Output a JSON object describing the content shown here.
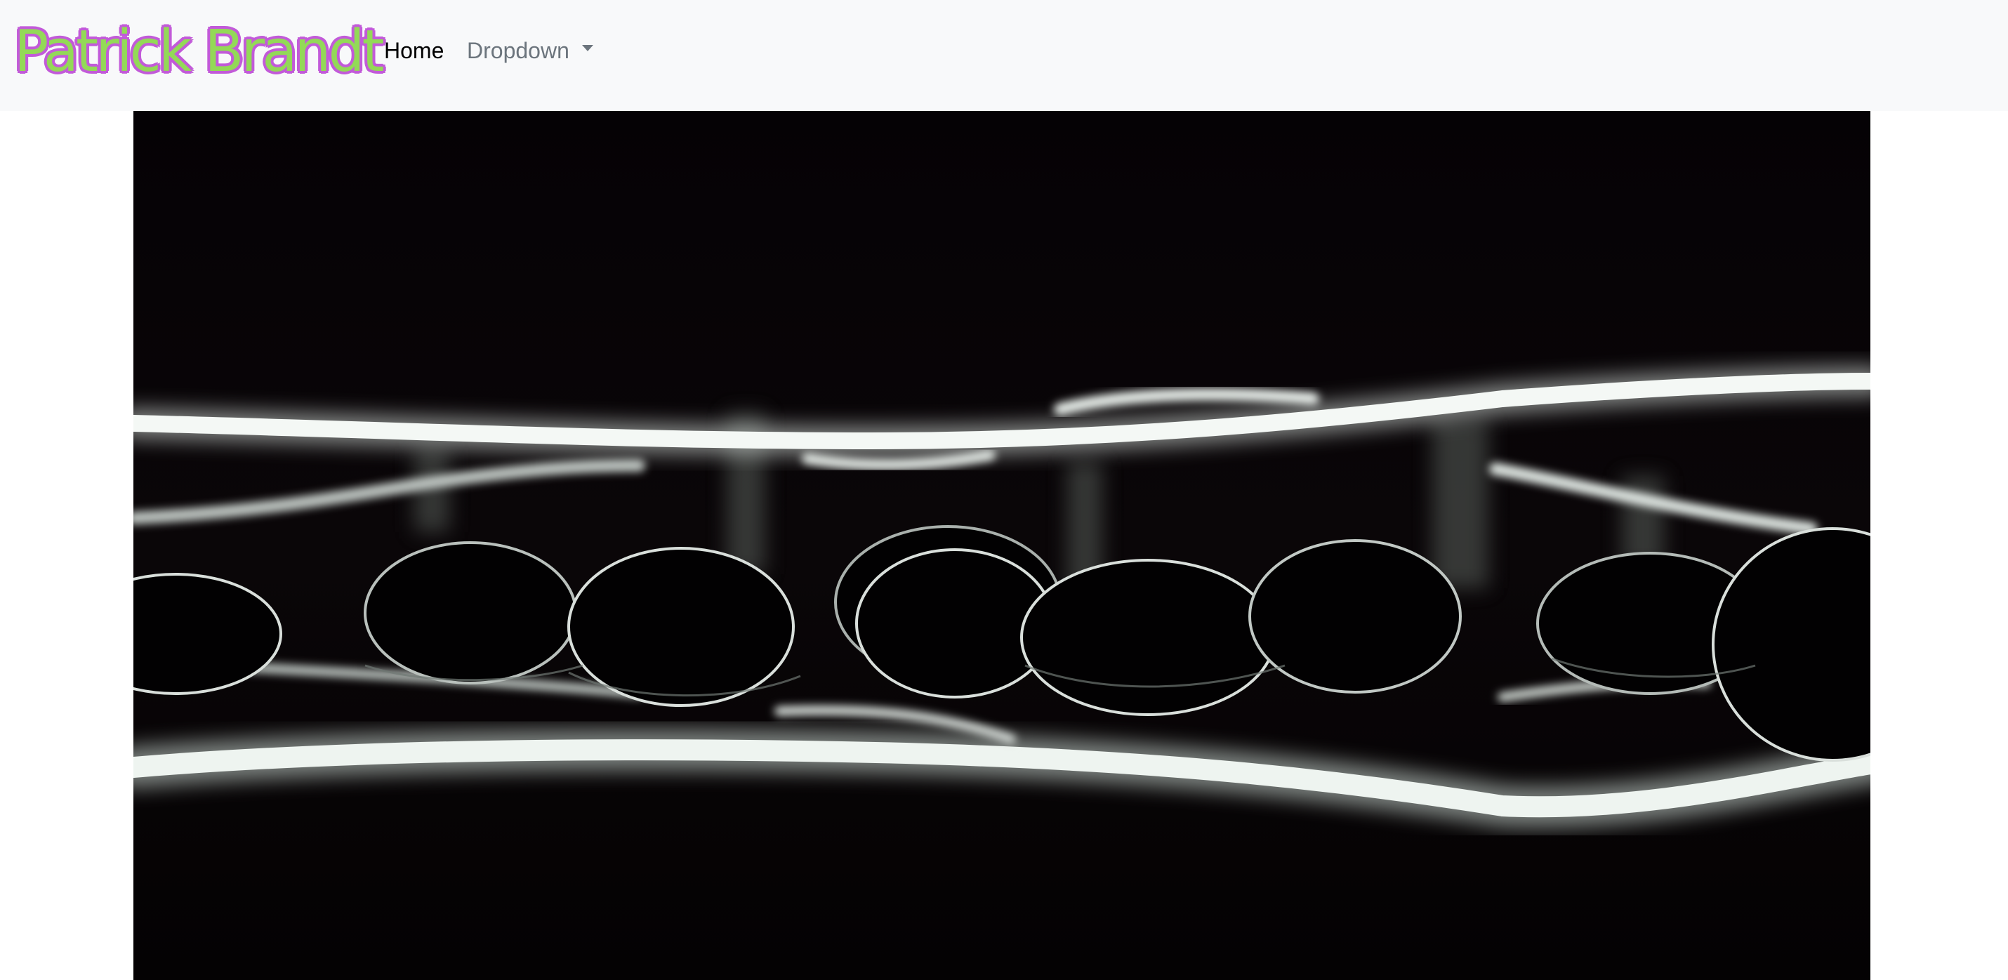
{
  "navbar": {
    "brand": "Patrick Brandt",
    "links": [
      {
        "label": "Home",
        "active": true
      },
      {
        "label": "Dropdown",
        "has_caret": true
      }
    ]
  },
  "colors": {
    "navbar_bg": "#f8f9fa",
    "brand_fill": "#93d957",
    "brand_outline": "#c25ad9",
    "link_active": "#000000",
    "link_muted": "#6c757d",
    "photo_bg": "#030103"
  },
  "hero": {
    "icon": "hero-photo",
    "subject": "abstract"
  }
}
